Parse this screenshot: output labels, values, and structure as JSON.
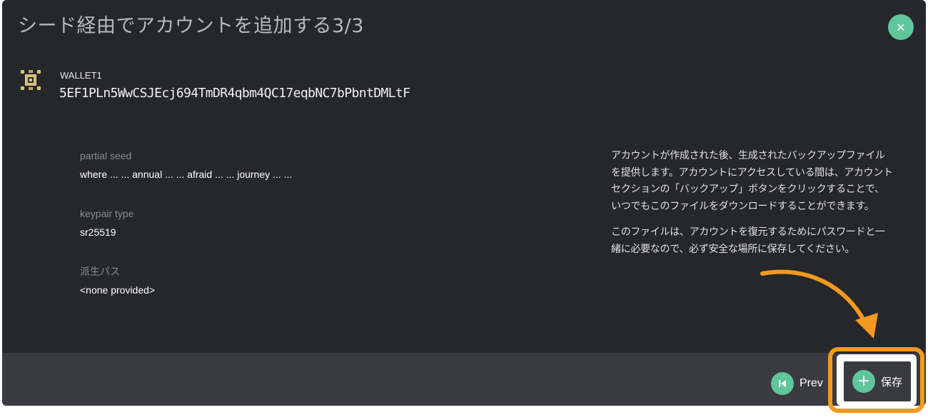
{
  "modal": {
    "title": "シード経由でアカウントを追加する3/3",
    "close_icon": "close-icon"
  },
  "account": {
    "icon": "account-avatar-icon",
    "name": "WALLET1",
    "address": "5EF1PLn5WwCSJEcj694TmDR4qbm4QC17eqbNC7bPbntDMLtF"
  },
  "fields": {
    "partial_seed_label": "partial seed",
    "partial_seed_value": "where ... ... annual ... ... afraid ... ... journey ... ...",
    "keypair_type_label": "keypair type",
    "keypair_type_value": "sr25519",
    "derivation_path_label": "派生パス",
    "derivation_path_value": "<none provided>"
  },
  "info": {
    "paragraph1": "アカウントが作成された後、生成されたバックアップファイルを提供します。アカウントにアクセスしている間は、アカウントセクションの「バックアップ」ボタンをクリックすることで、いつでもこのファイルをダウンロードすることができます。",
    "paragraph2": "このファイルは、アカウントを復元するためにパスワードと一緒に必要なので、必ず安全な場所に保存してください。"
  },
  "footer": {
    "prev_label": "Prev",
    "prev_icon": "skip-back-icon",
    "save_label": "保存",
    "save_icon": "plus-icon"
  },
  "colors": {
    "background": "#26272b",
    "footer": "#3a3b40",
    "accent": "#5fc69b",
    "highlight": "#f29a1f"
  }
}
